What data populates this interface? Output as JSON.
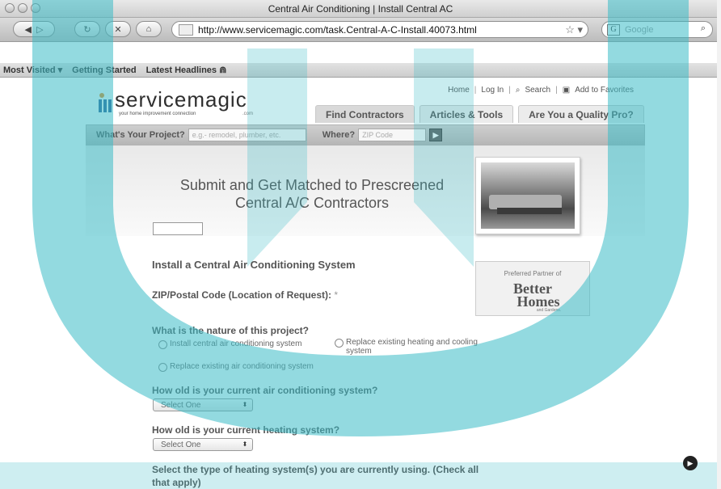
{
  "window": {
    "title": "Central Air Conditioning | Install Central AC"
  },
  "browser": {
    "url": "http://www.servicemagic.com/task.Central-A-C-Install.40073.html",
    "search_placeholder": "Google",
    "bookmarks": [
      "Most Visited ▾",
      "Getting Started",
      "Latest Headlines ⋒"
    ]
  },
  "site": {
    "logo_text": "servicemagic",
    "logo_tagline": "your home improvement connection",
    "logo_com": ".com",
    "top_links": [
      "Home",
      "Log In",
      "Search",
      "Add to Favorites"
    ],
    "tabs": [
      "Find Contractors",
      "Articles & Tools",
      "Are You a Quality Pro?"
    ],
    "strip": {
      "project_label": "What's Your Project?",
      "project_placeholder": "e.g.- remodel, plumber, etc.",
      "where_label": "Where?",
      "zip_placeholder": "ZIP Code"
    },
    "hero_line1": "Submit and Get Matched to Prescreened",
    "hero_line2": "Central A/C Contractors",
    "partner": {
      "label": "Preferred Partner of",
      "logo_line1": "Better",
      "logo_line2": "Homes",
      "logo_sub": "and Gardens."
    }
  },
  "form": {
    "title": "Install a Central Air Conditioning System",
    "zip_label": "ZIP/Postal Code (Location of Request):",
    "zip_required": "*",
    "nature_question": "What is the nature of this project?",
    "nature_options": [
      "Install central air conditioning system",
      "Replace existing heating and cooling system",
      "Replace existing air conditioning system"
    ],
    "ac_age_question": "How old is your current air conditioning system?",
    "heating_age_question": "How old is your current heating system?",
    "select_default": "Select One",
    "heating_type_question": "Select the type of heating system(s) you are currently using. (Check all",
    "heating_type_question_line2": "that apply)"
  },
  "colors": {
    "watermark": "#3bbbc7"
  }
}
